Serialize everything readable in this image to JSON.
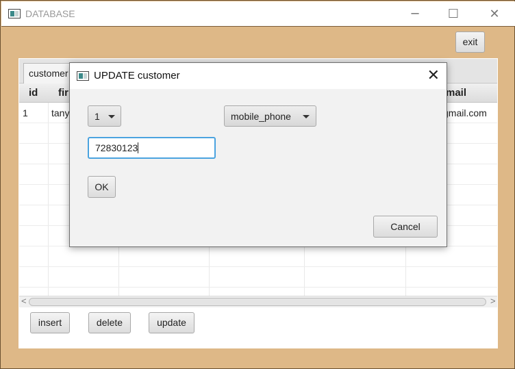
{
  "window": {
    "title": "DATABASE",
    "controls": {
      "minimize": "─",
      "maximize": "☐",
      "close": "✕"
    }
  },
  "toolbar": {
    "exit_label": "exit"
  },
  "tabs": [
    {
      "label": "customer"
    }
  ],
  "table": {
    "columns": [
      "id",
      "fir",
      "mail"
    ],
    "rows": [
      {
        "id": "1",
        "first": "tany",
        "email": "gmail.com"
      }
    ]
  },
  "scrollbar": {
    "left_arrow": "<",
    "right_arrow": ">"
  },
  "actions": {
    "insert_label": "insert",
    "delete_label": "delete",
    "update_label": "update"
  },
  "dialog": {
    "title": "UPDATE customer",
    "close_glyph": "✕",
    "id_select": {
      "value": "1"
    },
    "field_select": {
      "value": "mobile_phone"
    },
    "value_input": {
      "value": "72830123"
    },
    "ok_label": "OK",
    "cancel_label": "Cancel"
  },
  "colors": {
    "window_bg": "#deb887",
    "focus_border": "#4aa3df"
  }
}
